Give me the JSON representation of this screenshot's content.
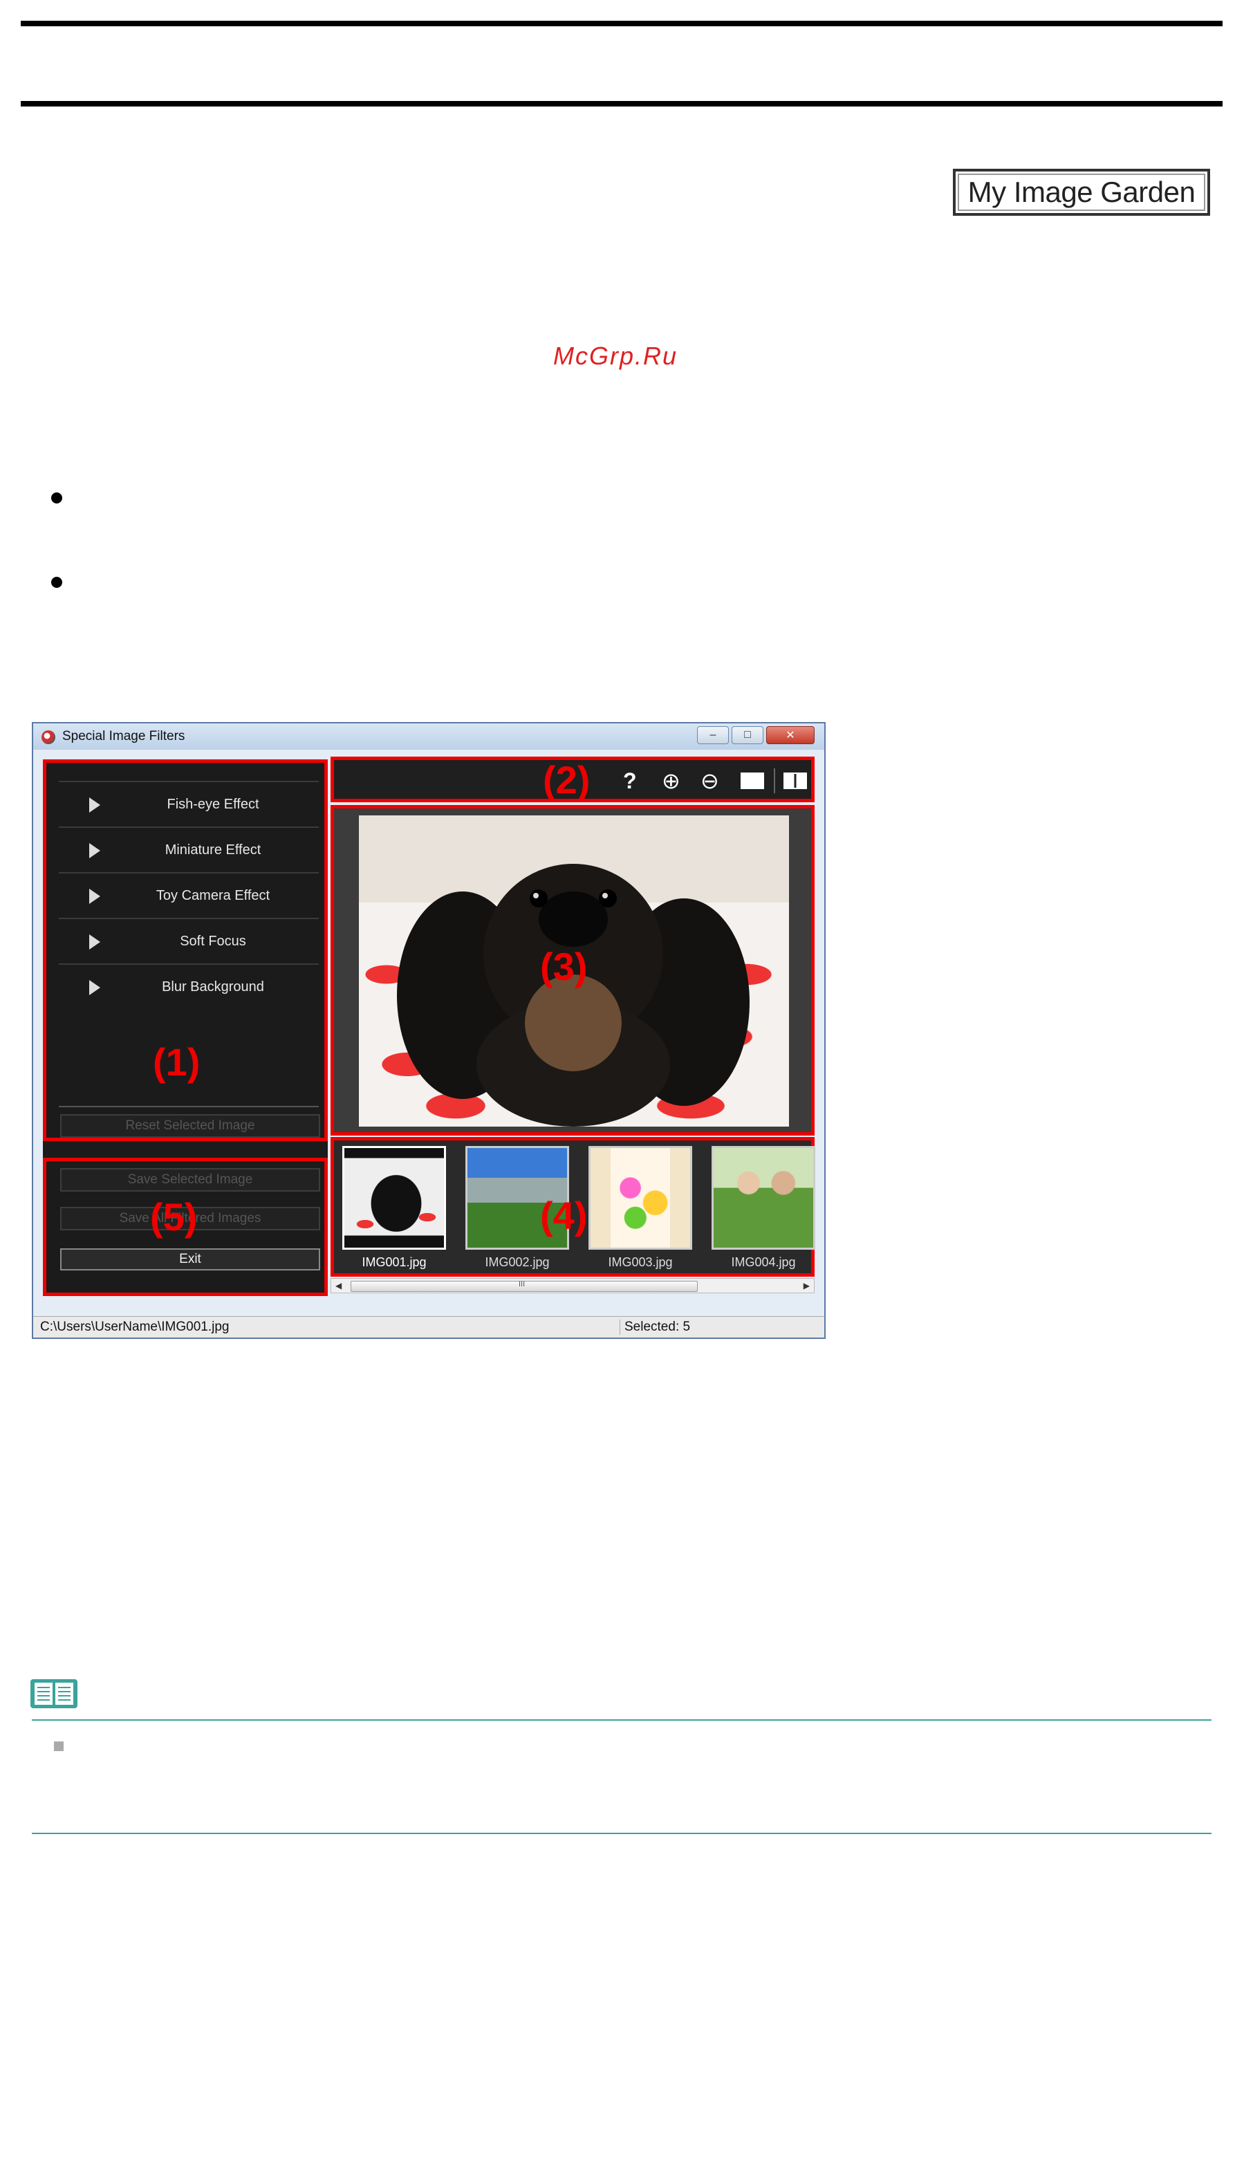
{
  "header": {
    "badge": "My Image Garden"
  },
  "window": {
    "title": "Special Image Filters",
    "controls": {
      "minimize": "–",
      "maximize": "□",
      "close": "✕"
    },
    "filters": [
      "Fish-eye Effect",
      "Miniature Effect",
      "Toy Camera Effect",
      "Soft Focus",
      "Blur Background"
    ],
    "buttons": {
      "reset": "Reset Selected Image",
      "save_selected": "Save Selected Image",
      "save_all": "Save All Filtered Images",
      "exit": "Exit"
    },
    "callouts": {
      "one": "(1)",
      "two": "(2)",
      "three": "(3)",
      "four": "(4)",
      "five": "(5)"
    },
    "toolbar": {
      "help": "?",
      "zoom_in": "⊕",
      "zoom_out": "⊖"
    },
    "thumbnails": [
      {
        "name": "IMG001.jpg",
        "selected": true
      },
      {
        "name": "IMG002.jpg",
        "selected": false
      },
      {
        "name": "IMG003.jpg",
        "selected": false
      },
      {
        "name": "IMG004.jpg",
        "selected": false
      }
    ],
    "scrollbar": {
      "center_mark": "III"
    },
    "status": {
      "path": "C:\\Users\\UserName\\IMG001.jpg",
      "selected": "Selected: 5"
    }
  },
  "watermark": "McGrp.Ru",
  "icons": [
    "app-icon",
    "play-triangle-icon",
    "help-icon",
    "zoom-in-icon",
    "zoom-out-icon",
    "full-screen-icon",
    "compare-view-icon",
    "note-book-icon"
  ],
  "colors": {
    "callout_red": "#e00000",
    "note_rule": "#3aa39a"
  }
}
